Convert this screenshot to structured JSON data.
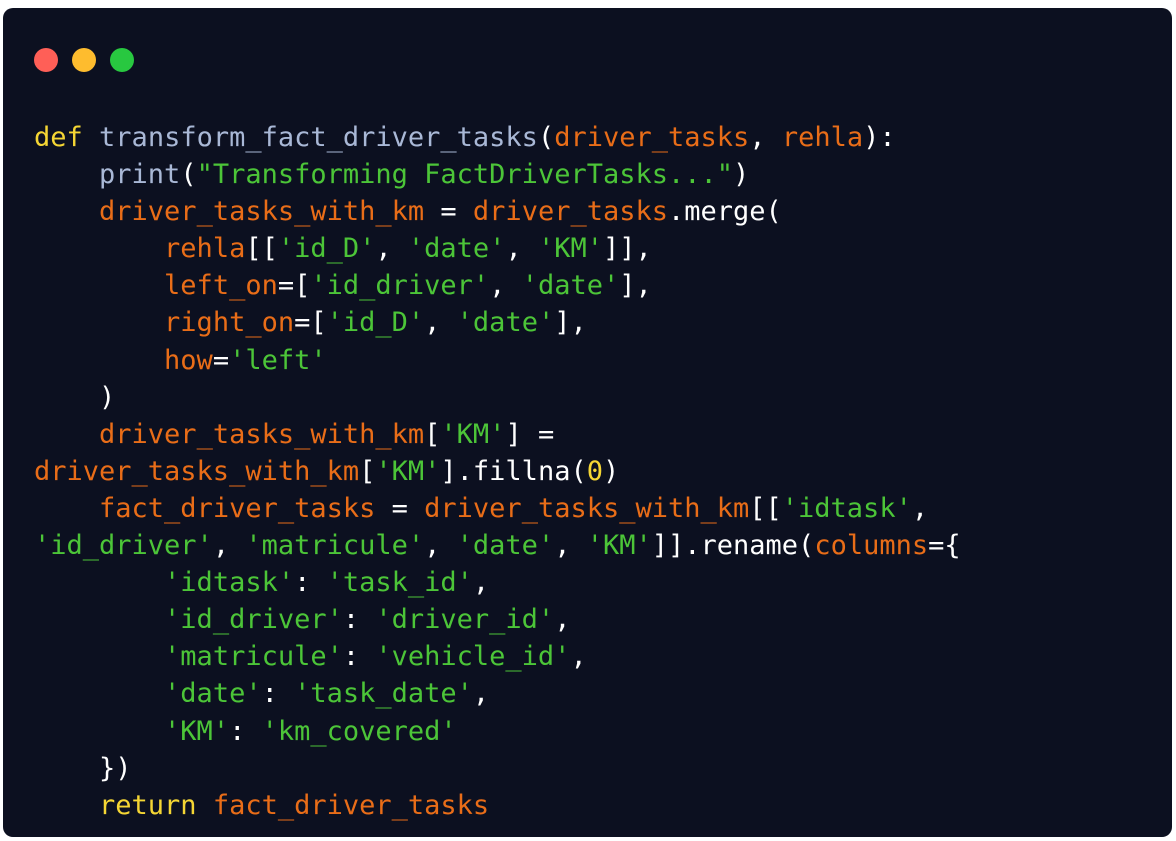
{
  "window": {
    "buttons": [
      {
        "name": "close",
        "color": "#ff5f57"
      },
      {
        "name": "minimize",
        "color": "#febc2e"
      },
      {
        "name": "maximize",
        "color": "#28c840"
      }
    ]
  },
  "colors": {
    "background": "#0c1020",
    "keyword": "#f5d634",
    "function": "#a9b8d6",
    "variable": "#e96d18",
    "string": "#4cc538",
    "number": "#f5d634",
    "plain": "#ffffff"
  },
  "code": {
    "language": "python",
    "lines": [
      [
        [
          "keyword",
          "def"
        ],
        [
          "plain",
          " "
        ],
        [
          "funcname",
          "transform_fact_driver_tasks"
        ],
        [
          "plain",
          "("
        ],
        [
          "param",
          "driver_tasks"
        ],
        [
          "plain",
          ", "
        ],
        [
          "param",
          "rehla"
        ],
        [
          "plain",
          "):"
        ]
      ],
      [
        [
          "plain",
          "    "
        ],
        [
          "builtin",
          "print"
        ],
        [
          "plain",
          "("
        ],
        [
          "string",
          "\"Transforming FactDriverTasks...\""
        ],
        [
          "plain",
          ")"
        ]
      ],
      [
        [
          "plain",
          "    "
        ],
        [
          "var",
          "driver_tasks_with_km"
        ],
        [
          "plain",
          " = "
        ],
        [
          "var",
          "driver_tasks"
        ],
        [
          "plain",
          ".merge("
        ]
      ],
      [
        [
          "plain",
          "        "
        ],
        [
          "var",
          "rehla"
        ],
        [
          "plain",
          "[["
        ],
        [
          "string",
          "'id_D'"
        ],
        [
          "plain",
          ", "
        ],
        [
          "string",
          "'date'"
        ],
        [
          "plain",
          ", "
        ],
        [
          "string",
          "'KM'"
        ],
        [
          "plain",
          "]],"
        ]
      ],
      [
        [
          "plain",
          "        "
        ],
        [
          "var",
          "left_on"
        ],
        [
          "plain",
          "=["
        ],
        [
          "string",
          "'id_driver'"
        ],
        [
          "plain",
          ", "
        ],
        [
          "string",
          "'date'"
        ],
        [
          "plain",
          "],"
        ]
      ],
      [
        [
          "plain",
          "        "
        ],
        [
          "var",
          "right_on"
        ],
        [
          "plain",
          "=["
        ],
        [
          "string",
          "'id_D'"
        ],
        [
          "plain",
          ", "
        ],
        [
          "string",
          "'date'"
        ],
        [
          "plain",
          "],"
        ]
      ],
      [
        [
          "plain",
          "        "
        ],
        [
          "var",
          "how"
        ],
        [
          "plain",
          "="
        ],
        [
          "string",
          "'left'"
        ]
      ],
      [
        [
          "plain",
          "    )"
        ]
      ],
      [
        [
          "plain",
          "    "
        ],
        [
          "var",
          "driver_tasks_with_km"
        ],
        [
          "plain",
          "["
        ],
        [
          "string",
          "'KM'"
        ],
        [
          "plain",
          "] ="
        ]
      ],
      [
        [
          "var",
          "driver_tasks_with_km"
        ],
        [
          "plain",
          "["
        ],
        [
          "string",
          "'KM'"
        ],
        [
          "plain",
          "].fillna("
        ],
        [
          "number",
          "0"
        ],
        [
          "plain",
          ")"
        ]
      ],
      [
        [
          "plain",
          "    "
        ],
        [
          "var",
          "fact_driver_tasks"
        ],
        [
          "plain",
          " = "
        ],
        [
          "var",
          "driver_tasks_with_km"
        ],
        [
          "plain",
          "[["
        ],
        [
          "string",
          "'idtask'"
        ],
        [
          "plain",
          ","
        ]
      ],
      [
        [
          "string",
          "'id_driver'"
        ],
        [
          "plain",
          ", "
        ],
        [
          "string",
          "'matricule'"
        ],
        [
          "plain",
          ", "
        ],
        [
          "string",
          "'date'"
        ],
        [
          "plain",
          ", "
        ],
        [
          "string",
          "'KM'"
        ],
        [
          "plain",
          "]].rename("
        ],
        [
          "var",
          "columns"
        ],
        [
          "plain",
          "={"
        ]
      ],
      [
        [
          "plain",
          "        "
        ],
        [
          "string",
          "'idtask'"
        ],
        [
          "plain",
          ": "
        ],
        [
          "string",
          "'task_id'"
        ],
        [
          "plain",
          ","
        ]
      ],
      [
        [
          "plain",
          "        "
        ],
        [
          "string",
          "'id_driver'"
        ],
        [
          "plain",
          ": "
        ],
        [
          "string",
          "'driver_id'"
        ],
        [
          "plain",
          ","
        ]
      ],
      [
        [
          "plain",
          "        "
        ],
        [
          "string",
          "'matricule'"
        ],
        [
          "plain",
          ": "
        ],
        [
          "string",
          "'vehicle_id'"
        ],
        [
          "plain",
          ","
        ]
      ],
      [
        [
          "plain",
          "        "
        ],
        [
          "string",
          "'date'"
        ],
        [
          "plain",
          ": "
        ],
        [
          "string",
          "'task_date'"
        ],
        [
          "plain",
          ","
        ]
      ],
      [
        [
          "plain",
          "        "
        ],
        [
          "string",
          "'KM'"
        ],
        [
          "plain",
          ": "
        ],
        [
          "string",
          "'km_covered'"
        ]
      ],
      [
        [
          "plain",
          "    })"
        ]
      ],
      [
        [
          "plain",
          "    "
        ],
        [
          "keyword",
          "return"
        ],
        [
          "plain",
          " "
        ],
        [
          "var",
          "fact_driver_tasks"
        ]
      ]
    ]
  }
}
